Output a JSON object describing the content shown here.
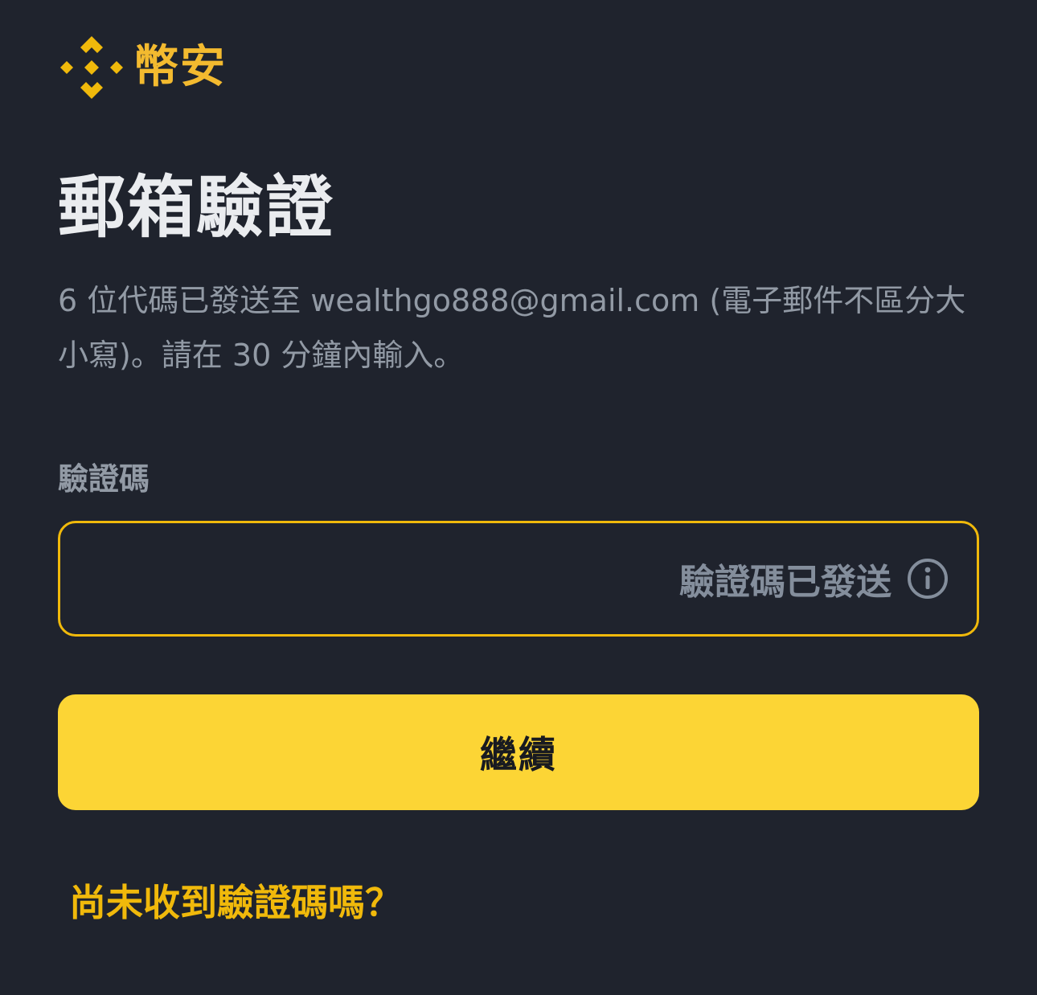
{
  "brand": {
    "name": "幣安",
    "accent_color": "#F0B90B",
    "logo_icon": "binance-diamond-icon"
  },
  "page": {
    "title": "郵箱驗證",
    "description": "6 位代碼已發送至 wealthgo888@gmail.com (電子郵件不區分大小寫)。請在 30 分鐘內輸入。"
  },
  "code_field": {
    "label": "驗證碼",
    "value": "",
    "status_text": "驗證碼已發送",
    "info_icon": "info-icon"
  },
  "actions": {
    "continue_label": "繼續",
    "resend_link": "尚未收到驗證碼嗎？"
  },
  "colors": {
    "background": "#1F232D",
    "primary_button": "#FCD535",
    "input_border": "#F0B90B",
    "muted_text": "#929AA5"
  }
}
